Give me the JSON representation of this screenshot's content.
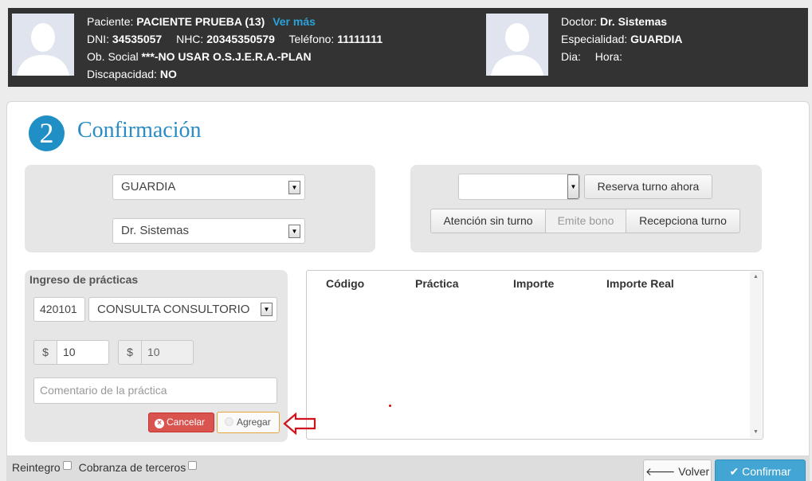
{
  "patient": {
    "paciente_label": "Paciente:",
    "paciente_value": "PACIENTE PRUEBA (13)",
    "ver_mas": "Ver más",
    "dni_label": "DNI:",
    "dni_value": "34535057",
    "nhc_label": "NHC:",
    "nhc_value": "20345350579",
    "telefono_label": "Teléfono:",
    "telefono_value": "11111111",
    "obsocial_label": "Ob. Social",
    "obsocial_value": "***-NO USAR O.S.J.E.R.A.-PLAN",
    "discapacidad_label": "Discapacidad:",
    "discapacidad_value": "NO"
  },
  "doctor": {
    "doctor_label": "Doctor:",
    "doctor_value": "Dr. Sistemas",
    "especialidad_label": "Especialidad:",
    "especialidad_value": "GUARDIA",
    "dia_label": "Dia:",
    "hora_label": "Hora:"
  },
  "step": {
    "number": "2",
    "title": "Confirmación"
  },
  "selection": {
    "especialidad": "GUARDIA",
    "profesional": "Dr. Sistemas"
  },
  "turno": {
    "select_value": "",
    "reserva_button": "Reserva turno ahora",
    "atencion_button": "Atención sin turno",
    "emite_button": "Emite bono",
    "recepciona_button": "Recepciona turno"
  },
  "practicas": {
    "label": "Ingreso de prácticas",
    "codigo": "420101",
    "practica": "CONSULTA CONSULTORIO",
    "currency1": "$",
    "importe": "10",
    "currency2": "$",
    "importe_real": "10",
    "comentario_placeholder": "Comentario de la práctica",
    "cancel_button": "Cancelar",
    "add_button": "Agregar"
  },
  "table": {
    "columns": [
      "Código",
      "Práctica",
      "Importe",
      "Importe Real"
    ]
  },
  "footer": {
    "reintegro_label": "Reintegro",
    "cobranza_label": "Cobranza de terceros",
    "volver_button": "Volver",
    "confirmar_button": "Confirmar"
  },
  "colors": {
    "header_bg": "#333333",
    "accent_blue": "#1f8fc6",
    "cancel_red": "#d9534f",
    "confirm_blue": "#42a5d3"
  }
}
